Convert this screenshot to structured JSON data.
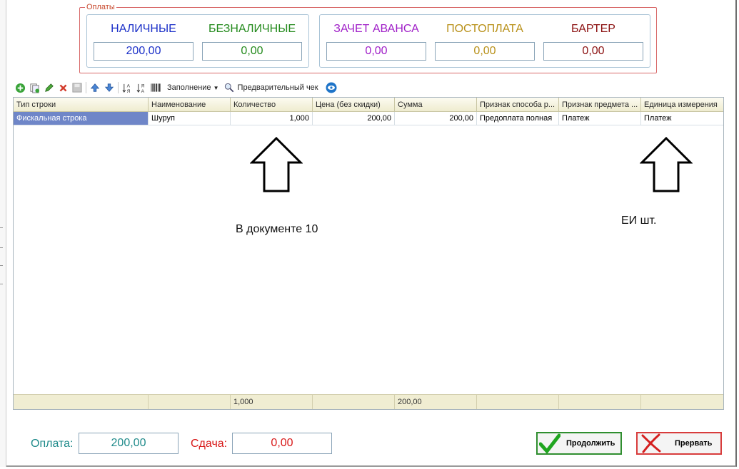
{
  "payments": {
    "legend": "Оплаты",
    "cash": {
      "label": "НАЛИЧНЫЕ",
      "value": "200,00",
      "color": "#1a2fc8"
    },
    "cashless": {
      "label": "БЕЗНАЛИЧНЫЕ",
      "value": "0,00",
      "color": "#238a1c"
    },
    "advance": {
      "label": "ЗАЧЕТ АВАНСА",
      "value": "0,00",
      "color": "#a020c8"
    },
    "postpay": {
      "label": "ПОСТОПЛАТА",
      "value": "0,00",
      "color": "#b89018"
    },
    "barter": {
      "label": "БАРТЕР",
      "value": "0,00",
      "color": "#8b1010"
    }
  },
  "toolbar": {
    "fill_label": "Заполнение",
    "preview_label": "Предварительный чек"
  },
  "table": {
    "columns": [
      "Тип строки",
      "Наименование",
      "Количество",
      "Цена (без скидки)",
      "Сумма",
      "Признак способа р...",
      "Признак предмета ...",
      "Единица измерения"
    ],
    "rows": [
      [
        "Фискальная строка",
        "Шуруп",
        "1,000",
        "200,00",
        "200,00",
        "Предоплата полная",
        "Платеж",
        "Платеж"
      ]
    ],
    "footer": [
      "",
      "",
      "1,000",
      "",
      "200,00",
      "",
      "",
      ""
    ]
  },
  "annotations": {
    "left_note": "В документе 10",
    "right_note": "ЕИ шт."
  },
  "bottom": {
    "payment_label": "Оплата:",
    "payment_value": "200,00",
    "change_label": "Сдача:",
    "change_value": "0,00",
    "continue_label": "Продолжить",
    "abort_label": "Прервать"
  }
}
